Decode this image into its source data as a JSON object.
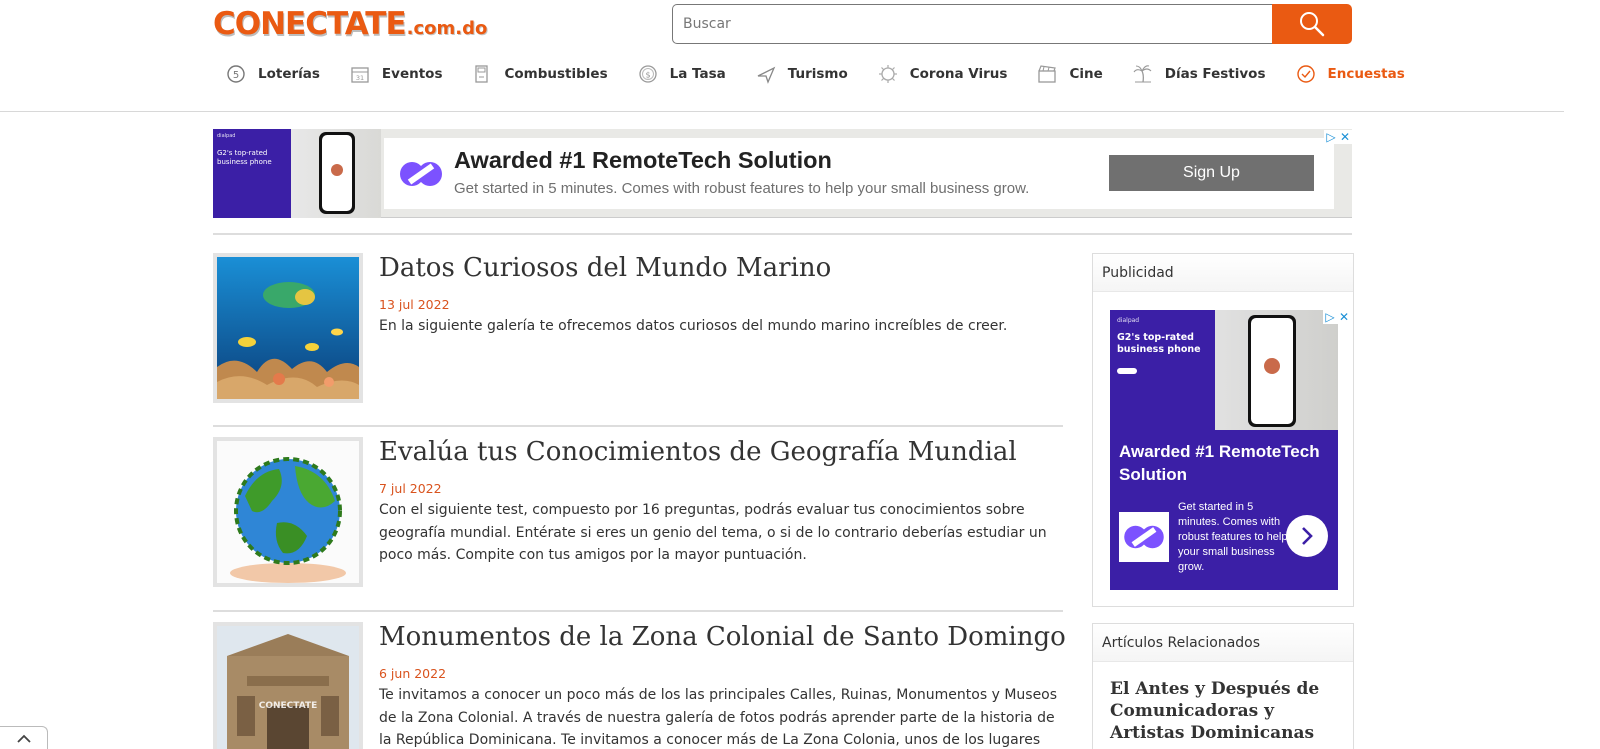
{
  "logo": {
    "main": "CONECTATE",
    "domain": ".com.do"
  },
  "search": {
    "placeholder": "Buscar"
  },
  "nav": [
    {
      "label": "Loterías",
      "icon": "lottery-coin-icon"
    },
    {
      "label": "Eventos",
      "icon": "calendar-icon"
    },
    {
      "label": "Combustibles",
      "icon": "fuel-icon"
    },
    {
      "label": "La Tasa",
      "icon": "dollar-coin-icon"
    },
    {
      "label": "Turismo",
      "icon": "airplane-icon"
    },
    {
      "label": "Corona Virus",
      "icon": "virus-icon"
    },
    {
      "label": "Cine",
      "icon": "clapperboard-icon"
    },
    {
      "label": "Días Festivos",
      "icon": "palm-tree-icon"
    },
    {
      "label": "Encuestas",
      "icon": "check-circle-icon",
      "active": true
    }
  ],
  "top_ad": {
    "left_brand": "dialpad",
    "left_text": "G2's top-rated business phone",
    "headline": "Awarded #1 RemoteTech Solution",
    "sub": "Get started in 5 minutes. Comes with robust features to help your small business grow.",
    "cta": "Sign Up"
  },
  "articles": [
    {
      "title": "Datos Curiosos del Mundo Marino",
      "date": "13 jul 2022",
      "summary": "En la siguiente galería te ofrecemos datos curiosos del mundo marino increíbles de creer."
    },
    {
      "title": "Evalúa tus Conocimientos de Geografía Mundial",
      "date": "7 jul 2022",
      "summary": "Con el siguiente test, compuesto por 16 preguntas, podrás evaluar tus conocimientos sobre geografía mundial. Entérate si eres un genio del tema, o si de lo contrario deberías estudiar un poco más. Compite con tus amigos por la mayor puntuación."
    },
    {
      "title": "Monumentos de la Zona Colonial de Santo Domingo",
      "date": "6 jun 2022",
      "summary": "Te invitamos a conocer un poco más de los las principales Calles, Ruinas, Monumentos y Museos de la Zona Colonial. A través de nuestra galería de fotos podrás aprender parte de la historia de la República Dominicana. Te invitamos a conocer más de La Zona Colonia, unos de los lugares"
    }
  ],
  "sidebar": {
    "ad_box_title": "Publicidad",
    "ad": {
      "brand": "dialpad",
      "small_headline": "G2's top-rated business phone",
      "headline": "Awarded #1 RemoteTech Solution",
      "desc": "Get started in 5 minutes. Comes with robust features to help your small business grow."
    },
    "related_title": "Artículos Relacionados",
    "related": [
      {
        "title": "El Antes y Después de Comunicadoras y Artistas Dominicanas"
      }
    ]
  },
  "colors": {
    "brand_orange": "#ea5a12",
    "date_orange": "#d9531e",
    "ad_purple": "#3b1fa6"
  }
}
